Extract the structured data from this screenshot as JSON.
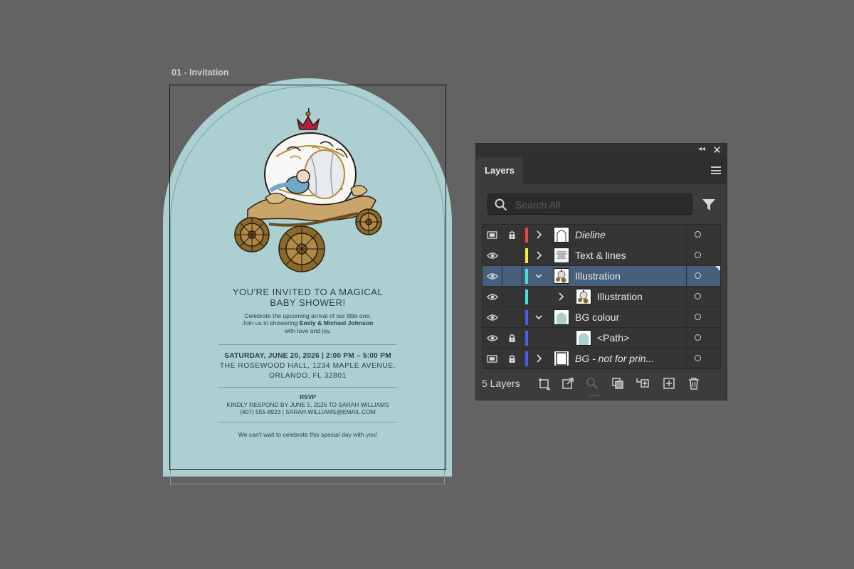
{
  "artboard": {
    "label": "01 - Invitation"
  },
  "invitation": {
    "title_line1": "YOU'RE INVITED TO A MAGICAL",
    "title_line2": "BABY SHOWER!",
    "celebrate_line": "Celebrate the upcoming arrival of our little one.",
    "join_prefix": "Join us in showering ",
    "join_names": "Emily & Michael Johnson",
    "love_line": "with love and joy.",
    "date_line": "SATURDAY, JUNE 20, 2026 | 2:00 PM – 5:00 PM",
    "venue_line": "THE ROSEWOOD HALL, 1234 MAPLE AVENUE,",
    "city_line": "ORLANDO, FL 32801",
    "rsvp_heading": "RSVP",
    "respond_line": "KINDLY RESPOND BY JUNE 5, 2026 TO SARAH WILLIAMS",
    "contact_line": "(407) 555-8923 | SARAH.WILLIAMS@EMAIL.COM",
    "closing_line": "We can't wait to celebrate this special day with you!"
  },
  "layers_panel": {
    "tab_label": "Layers",
    "search_placeholder": "Search All",
    "layer_count": "5 Layers",
    "rows": [
      {
        "name": "Dieline",
        "italic": true,
        "visibility": "template",
        "locked": true,
        "color": "#e8473f",
        "expand": "collapsed",
        "level": 0,
        "thumb": "dieline"
      },
      {
        "name": "Text & lines",
        "italic": false,
        "visibility": "visible",
        "locked": false,
        "color": "#f4ec3f",
        "expand": "collapsed",
        "level": 0,
        "thumb": "text"
      },
      {
        "name": "Illustration",
        "italic": false,
        "visibility": "visible",
        "locked": false,
        "color": "#47e0e0",
        "expand": "expanded",
        "level": 0,
        "thumb": "illustration",
        "selected": true
      },
      {
        "name": "Illustration",
        "italic": false,
        "visibility": "visible",
        "locked": false,
        "color": "#47e0e0",
        "expand": "collapsed",
        "level": 1,
        "thumb": "illustration"
      },
      {
        "name": "BG colour",
        "italic": false,
        "visibility": "visible",
        "locked": false,
        "color": "#4b5ee8",
        "expand": "expanded",
        "level": 0,
        "thumb": "bg"
      },
      {
        "name": "<Path>",
        "italic": false,
        "visibility": "visible",
        "locked": true,
        "color": "#4b5ee8",
        "expand": "none",
        "level": 1,
        "thumb": "bg"
      },
      {
        "name": "BG - not for prin...",
        "italic": true,
        "visibility": "template",
        "locked": true,
        "color": "#4b5ee8",
        "expand": "collapsed",
        "level": 0,
        "thumb": "black"
      }
    ],
    "icons": [
      "collapse-panels-icon",
      "close-icon",
      "panel-menu-icon",
      "search-icon",
      "filter-icon",
      "collect-for-export-icon",
      "export-icon",
      "locate-object-icon",
      "make-clipping-mask-icon",
      "create-sublayer-icon",
      "create-new-layer-icon",
      "delete-layer-icon"
    ]
  },
  "colors": {
    "canvas": "#636363",
    "invitation_bg": "#acd0d2",
    "selection": "#46607b"
  }
}
